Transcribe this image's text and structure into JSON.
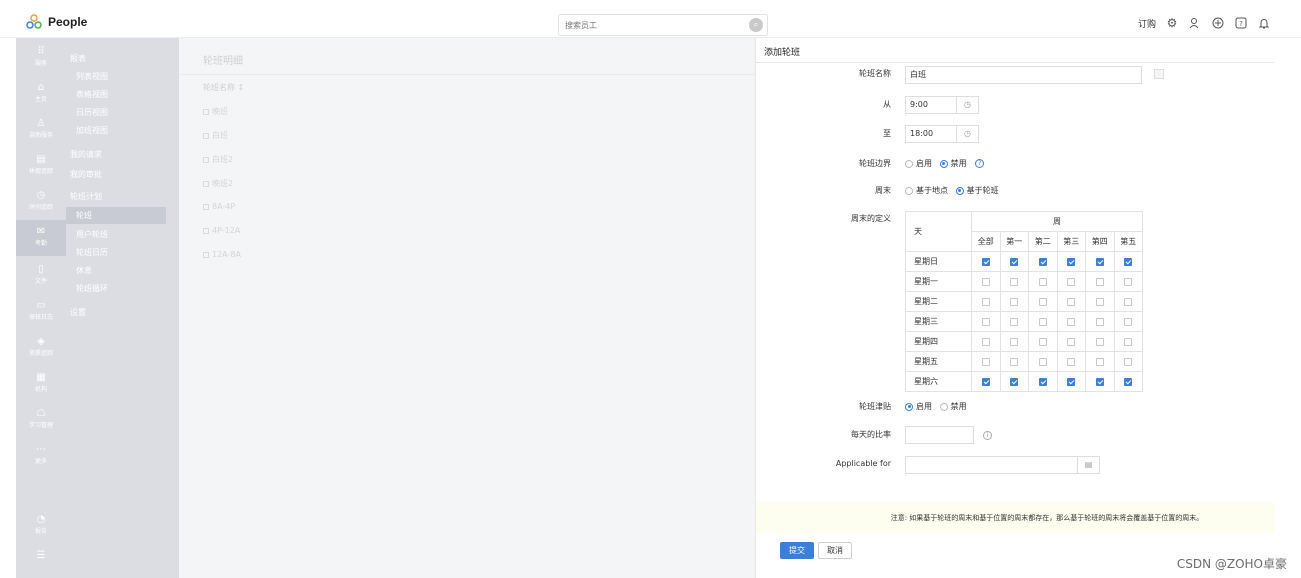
{
  "app": {
    "name": "People"
  },
  "search": {
    "placeholder": "搜索员工"
  },
  "topbar": {
    "subscribe_label": "订购"
  },
  "rail": [
    {
      "icon": "grid-icon",
      "label": "服务"
    },
    {
      "icon": "home-icon",
      "label": "主页"
    },
    {
      "icon": "user-icon",
      "label": "自助服务"
    },
    {
      "icon": "calendar-icon",
      "label": "休假追踪"
    },
    {
      "icon": "clock-icon",
      "label": "时间追踪"
    },
    {
      "icon": "mail-icon",
      "label": "考勤"
    },
    {
      "icon": "file-icon",
      "label": "文件"
    },
    {
      "icon": "doc-icon",
      "label": "审核日志"
    },
    {
      "icon": "tag-icon",
      "label": "资质追踪"
    },
    {
      "icon": "org-icon",
      "label": "机构"
    },
    {
      "icon": "learn-icon",
      "label": "学习管理"
    },
    {
      "icon": "more-icon",
      "label": "更多"
    },
    {
      "icon": "report-icon",
      "label": "报告"
    },
    {
      "icon": "menu-icon",
      "label": ""
    }
  ],
  "subnav": {
    "section_reports": "报表",
    "reports_items": [
      "列表视图",
      "表格视图",
      "日历视图",
      "加班视图"
    ],
    "my_requests": "我的请求",
    "my_approvals": "我的审批",
    "shift_plan": "轮班计划",
    "shift_items": [
      "轮班",
      "用户轮班",
      "轮班日历",
      "休息",
      "轮班循环"
    ],
    "settings": "设置"
  },
  "content": {
    "title": "轮班明细",
    "col_head": "轮班名称",
    "rows": [
      "晚班",
      "白班",
      "白班2",
      "晚班2",
      "8A-4P",
      "4P-12A",
      "12A-8A"
    ]
  },
  "panel": {
    "title": "添加轮班",
    "name_label": "轮班名称",
    "name_value": "白班",
    "from_label": "从",
    "from_value": "9:00",
    "to_label": "至",
    "to_value": "18:00",
    "boundary_label": "轮班边界",
    "enable": "启用",
    "disable": "禁用",
    "weekend_label": "周末",
    "weekend_by_location": "基于地点",
    "weekend_by_shift": "基于轮班",
    "weekend_def_label": "周末的定义",
    "grid": {
      "day_head": "天",
      "week_head": "周",
      "cols": [
        "全部",
        "第一",
        "第二",
        "第三",
        "第四",
        "第五"
      ],
      "rows": [
        {
          "day": "星期日",
          "checked": [
            true,
            true,
            true,
            true,
            true,
            true
          ]
        },
        {
          "day": "星期一",
          "checked": [
            false,
            false,
            false,
            false,
            false,
            false
          ]
        },
        {
          "day": "星期二",
          "checked": [
            false,
            false,
            false,
            false,
            false,
            false
          ]
        },
        {
          "day": "星期三",
          "checked": [
            false,
            false,
            false,
            false,
            false,
            false
          ]
        },
        {
          "day": "星期四",
          "checked": [
            false,
            false,
            false,
            false,
            false,
            false
          ]
        },
        {
          "day": "星期五",
          "checked": [
            false,
            false,
            false,
            false,
            false,
            false
          ]
        },
        {
          "day": "星期六",
          "checked": [
            true,
            true,
            true,
            true,
            true,
            true
          ]
        }
      ]
    },
    "allowance_label": "轮班津贴",
    "daily_rate_label": "每天的比率",
    "applicable_label": "Applicable for",
    "note": "注意: 如果基于轮班的周末和基于位置的周末都存在，那么基于轮班的周末将会覆盖基于位置的周末。",
    "submit": "提交",
    "cancel": "取消"
  },
  "watermark": "CSDN @ZOHO卓豪",
  "colors": {
    "accent": "#3b7fd8",
    "sidebar": "#dcdde3"
  }
}
